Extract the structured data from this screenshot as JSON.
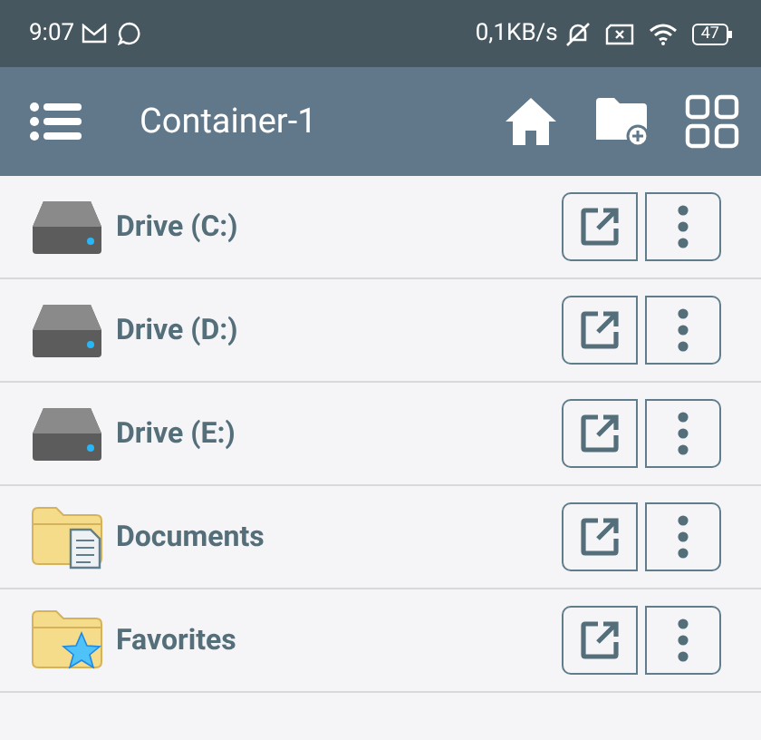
{
  "status_bar": {
    "time": "9:07",
    "speed": "0,1KB/s",
    "battery": "47"
  },
  "toolbar": {
    "title": "Container-1"
  },
  "items": [
    {
      "kind": "drive",
      "label": "Drive (C:)"
    },
    {
      "kind": "drive",
      "label": "Drive (D:)"
    },
    {
      "kind": "drive",
      "label": "Drive (E:)"
    },
    {
      "kind": "documents",
      "label": "Documents"
    },
    {
      "kind": "favorites",
      "label": "Favorites"
    }
  ]
}
